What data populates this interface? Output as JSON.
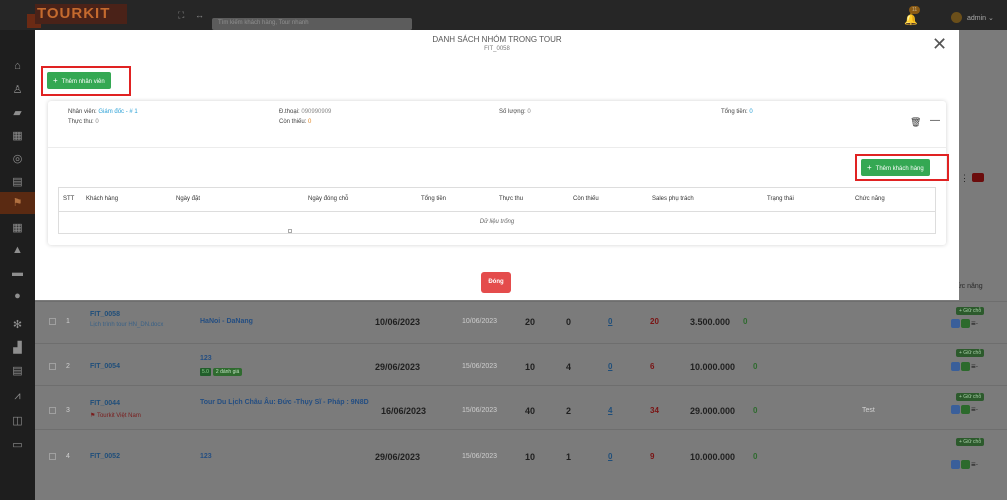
{
  "app": {
    "logo": "TOURKIT",
    "search_placeholder": "Tìm kiếm khách hàng, Tour nhanh",
    "notifications": "11",
    "user": "admin ⌄"
  },
  "modal": {
    "title": "DANH SÁCH NHÓM TRONG TOUR",
    "subtitle": "FIT_0058",
    "add_staff_label": "Thêm nhân viên",
    "group": {
      "staff_label": "Nhân viên:",
      "staff_value": "Giám đốc - # 1",
      "phone_label": "Đ.thoại:",
      "phone_value": "090990909",
      "qty_label": "Số lượng:",
      "qty_value": "0",
      "total_label": "Tổng tiền:",
      "total_value": "0",
      "paid_label": "Thực thu:",
      "paid_value": "0",
      "remaining_label": "Còn thiếu:",
      "remaining_value": "0",
      "add_customer_label": "Thêm khách hàng",
      "columns": [
        "STT",
        "Khách hàng",
        "Ngày đặt",
        "Ngày đóng chỗ",
        "Tổng tiền",
        "Thực thu",
        "Còn thiếu",
        "Sales phụ trách",
        "Trạng thái",
        "Chức năng"
      ],
      "empty_text": "Dữ liệu trống"
    },
    "close_label": "Đóng"
  },
  "background": {
    "right_header": "ức năng",
    "hold_label": "+ Giữ chỗ",
    "rows": [
      {
        "no": "1",
        "code": "FIT_0058",
        "note": "Lịch trình tour HN_DN.docx",
        "tour": "HaNoi - DaNang",
        "tag": "",
        "date": "10/06/2023",
        "date2": "10/06/2023",
        "qty": "20",
        "a": "0",
        "b": "0",
        "c": "20",
        "money": "3.500.000",
        "zero": "0",
        "status": ""
      },
      {
        "no": "2",
        "code": "FIT_0054",
        "note": "",
        "tour": "123",
        "tag": "2 đánh giá",
        "date": "29/06/2023",
        "date2": "15/06/2023",
        "qty": "10",
        "a": "4",
        "b": "0",
        "c": "6",
        "money": "10.000.000",
        "zero": "0",
        "status": ""
      },
      {
        "no": "3",
        "code": "FIT_0044",
        "note": "Tourkit Việt Nam",
        "tour": "Tour Du Lịch Châu Âu: Đức -Thụy Sĩ - Pháp : 9N8D",
        "tag": "",
        "date": "16/06/2023",
        "date2": "15/06/2023",
        "qty": "40",
        "a": "2",
        "b": "4",
        "c": "34",
        "money": "29.000.000",
        "zero": "0",
        "status": "Test"
      },
      {
        "no": "4",
        "code": "FIT_0052",
        "note": "",
        "tour": "123",
        "tag": "",
        "date": "29/06/2023",
        "date2": "15/06/2023",
        "qty": "10",
        "a": "1",
        "b": "0",
        "c": "9",
        "money": "10.000.000",
        "zero": "0",
        "status": ""
      }
    ]
  },
  "colors": {
    "primary_green": "#34a853",
    "danger_red": "#e44c4c",
    "highlight_red": "#e02222",
    "link_blue": "#2aa0d6"
  }
}
